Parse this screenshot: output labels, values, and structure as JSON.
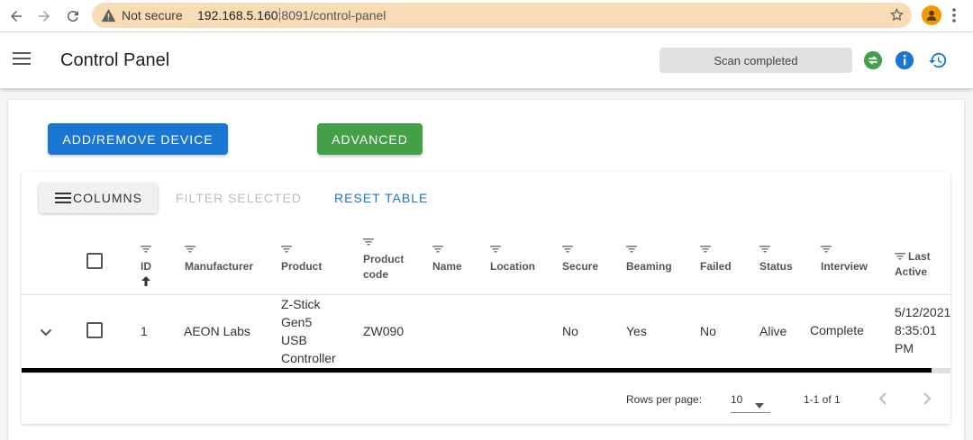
{
  "browser": {
    "security_label": "Not secure",
    "url_host": "192.168.5.160",
    "url_rest": ":8091/control-panel"
  },
  "appbar": {
    "title": "Control Panel",
    "scan_status": "Scan completed"
  },
  "actions": {
    "add_remove_label": "ADD/REMOVE DEVICE",
    "advanced_label": "ADVANCED"
  },
  "toolbar": {
    "columns_label": "COLUMNS",
    "filter_selected_label": "FILTER SELECTED",
    "reset_table_label": "RESET TABLE"
  },
  "table": {
    "headers": {
      "id": "ID",
      "manufacturer": "Manufacturer",
      "product": "Product",
      "product_code_1": "Product",
      "product_code_2": "code",
      "name": "Name",
      "location": "Location",
      "secure": "Secure",
      "beaming": "Beaming",
      "failed": "Failed",
      "status": "Status",
      "interview": "Interview",
      "last_active_1": "Last",
      "last_active_2": "Active"
    },
    "rows": [
      {
        "id": "1",
        "manufacturer": "AEON Labs",
        "product_lines": [
          "Z-Stick",
          "Gen5",
          "USB",
          "Controller"
        ],
        "product_code": "ZW090",
        "name": "",
        "location": "",
        "secure": "No",
        "beaming": "Yes",
        "failed": "No",
        "status": "Alive",
        "interview": "Complete",
        "last_active_lines": [
          "5/12/2021",
          "8:35:01",
          "PM"
        ]
      }
    ]
  },
  "pagination": {
    "rows_per_page_label": "Rows per page:",
    "rows_per_page_value": "10",
    "range": "1-1 of 1"
  },
  "colors": {
    "primary": "#1976d2",
    "success": "#43a047",
    "omnibox": "#f7dcb6"
  }
}
